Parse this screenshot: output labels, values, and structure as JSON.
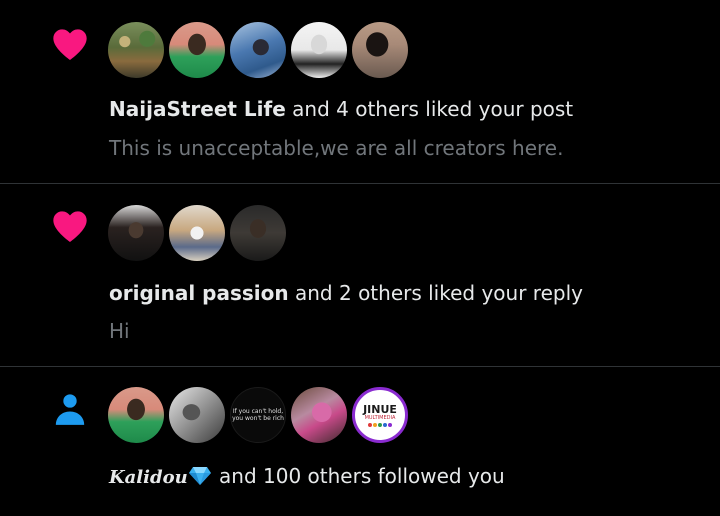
{
  "notifications": [
    {
      "type_icon": "heart-icon",
      "actor": "NaijaStreet Life",
      "action": " and 4 others liked your post",
      "preview": "This is unacceptable,we are all creators here."
    },
    {
      "type_icon": "heart-icon",
      "actor": "original passion",
      "action": " and 2 others liked your reply",
      "preview": "Hi"
    },
    {
      "type_icon": "person-icon",
      "actor": "Kalidou",
      "actor_emoji": "gem-icon",
      "action": " and 100 others followed you"
    }
  ],
  "avatar_text": {
    "quote_line1": "If you can't hold,",
    "quote_line2": "you won't be rich",
    "logo_main": "JINUE",
    "logo_sub": "MULTIMEDIA"
  },
  "colors": {
    "background": "#000000",
    "divider": "#2f3336",
    "primary_text": "#e7e9ea",
    "secondary_text": "#71767b",
    "like_pink": "#f91880",
    "follow_blue": "#1d9bf0"
  }
}
